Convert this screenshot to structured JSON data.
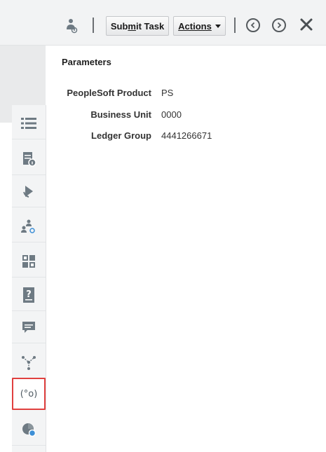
{
  "toolbar": {
    "user_icon": "user-settings-icon",
    "submit_label_pre": "Sub",
    "submit_label_under": "m",
    "submit_label_post": "it Task",
    "actions_label": "Actions",
    "prev_icon": "chevron-left-circle-icon",
    "next_icon": "chevron-right-circle-icon",
    "close_icon": "close-icon"
  },
  "sidebar": {
    "items": [
      {
        "icon": "list-icon"
      },
      {
        "icon": "document-info-icon"
      },
      {
        "icon": "bell-icon"
      },
      {
        "icon": "users-settings-icon"
      },
      {
        "icon": "grid-icon"
      },
      {
        "icon": "help-document-icon"
      },
      {
        "icon": "comment-icon"
      },
      {
        "icon": "hierarchy-icon"
      },
      {
        "icon": "parameters-icon",
        "label": "(°o)",
        "active": true
      },
      {
        "icon": "chart-icon"
      }
    ]
  },
  "main": {
    "title": "Parameters",
    "parameters": [
      {
        "label": "PeopleSoft Product",
        "value": "PS"
      },
      {
        "label": "Business Unit",
        "value": "0000"
      },
      {
        "label": "Ledger Group",
        "value": "4441266671"
      }
    ]
  },
  "colors": {
    "active_border": "#e0403f",
    "icon": "#6e7a83",
    "toolbar_bg": "#f2f3f4"
  }
}
